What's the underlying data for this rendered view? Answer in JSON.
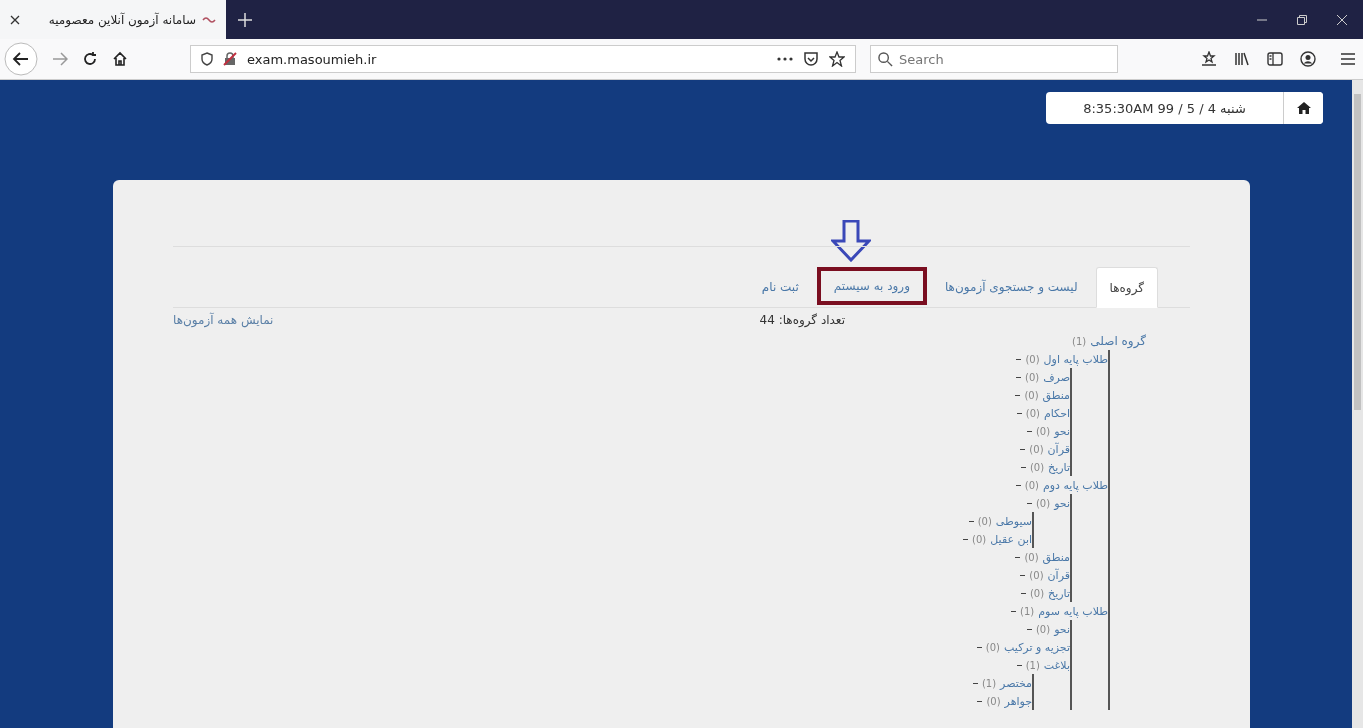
{
  "browser": {
    "tab_title": "سامانه آزمون آنلاین معصومیه",
    "url": "exam.masoumieh.ir",
    "search_placeholder": "Search"
  },
  "header": {
    "datetime": "شنبه 4 / 5 / 99 8:35:30AM"
  },
  "tabs": [
    {
      "label": "گروه‌ها",
      "selected": true,
      "highlighted": false
    },
    {
      "label": "لیست و جستجوی آزمون‌ها",
      "selected": false,
      "highlighted": false
    },
    {
      "label": "ورود به سیستم",
      "selected": false,
      "highlighted": true
    },
    {
      "label": "ثبت نام",
      "selected": false,
      "highlighted": false
    }
  ],
  "group_count": "تعداد گروه‌ها: 44",
  "show_all_link": "نمایش همه آزمون‌ها",
  "tree": [
    {
      "name": "گروه اصلی",
      "count": "(1)",
      "children": [
        {
          "name": "طلاب پایه اول",
          "count": "(0)",
          "children": [
            {
              "name": "صرف",
              "count": "(0)"
            },
            {
              "name": "منطق",
              "count": "(0)"
            },
            {
              "name": "احکام",
              "count": "(0)"
            },
            {
              "name": "نحو",
              "count": "(0)"
            },
            {
              "name": "قرآن",
              "count": "(0)"
            },
            {
              "name": "تاریخ",
              "count": "(0)"
            }
          ]
        },
        {
          "name": "طلاب پایه دوم",
          "count": "(0)",
          "children": [
            {
              "name": "نحو",
              "count": "(0)",
              "children": [
                {
                  "name": "سیوطی",
                  "count": "(0)"
                },
                {
                  "name": "ابن عقیل",
                  "count": "(0)"
                }
              ]
            },
            {
              "name": "منطق",
              "count": "(0)"
            },
            {
              "name": "قرآن",
              "count": "(0)"
            },
            {
              "name": "تاریخ",
              "count": "(0)"
            }
          ]
        },
        {
          "name": "طلاب پایه سوم",
          "count": "(1)",
          "children": [
            {
              "name": "نحو",
              "count": "(0)"
            },
            {
              "name": "تجزیه و ترکیب",
              "count": "(0)"
            },
            {
              "name": "بلاغت",
              "count": "(1)",
              "children": [
                {
                  "name": "مختصر",
                  "count": "(1)"
                },
                {
                  "name": "جواهر",
                  "count": "(0)"
                }
              ]
            }
          ]
        }
      ]
    }
  ]
}
